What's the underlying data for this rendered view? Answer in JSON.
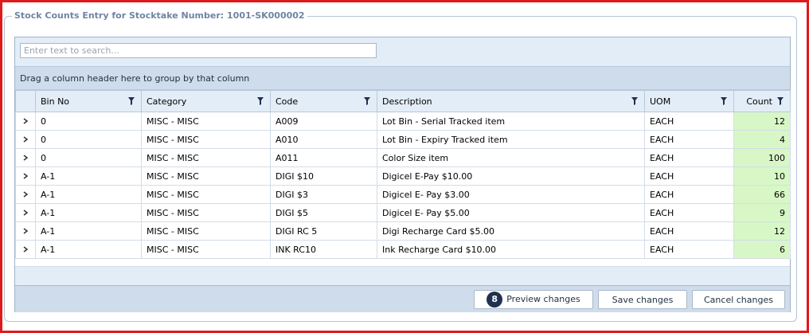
{
  "panel": {
    "title": "Stock Counts Entry for Stocktake Number: 1001-SK000002"
  },
  "search": {
    "placeholder": "Enter text to search..."
  },
  "group_panel": {
    "text": "Drag a column header here to group by that column"
  },
  "columns": [
    "Bin No",
    "Category",
    "Code",
    "Description",
    "UOM",
    "Count"
  ],
  "rows": [
    {
      "bin": "0",
      "category": "MISC - MISC",
      "code": "A009",
      "description": "Lot Bin - Serial Tracked item",
      "uom": "EACH",
      "count": "12"
    },
    {
      "bin": "0",
      "category": "MISC - MISC",
      "code": "A010",
      "description": "Lot Bin - Expiry Tracked item",
      "uom": "EACH",
      "count": "4"
    },
    {
      "bin": "0",
      "category": "MISC - MISC",
      "code": "A011",
      "description": "Color Size item",
      "uom": "EACH",
      "count": "100"
    },
    {
      "bin": "A-1",
      "category": "MISC - MISC",
      "code": "DIGI $10",
      "description": "Digicel E-Pay $10.00",
      "uom": "EACH",
      "count": "10"
    },
    {
      "bin": "A-1",
      "category": "MISC - MISC",
      "code": "DIGI $3",
      "description": "Digicel E- Pay $3.00",
      "uom": "EACH",
      "count": "66"
    },
    {
      "bin": "A-1",
      "category": "MISC - MISC",
      "code": "DIGI $5",
      "description": "Digicel E- Pay $5.00",
      "uom": "EACH",
      "count": "9"
    },
    {
      "bin": "A-1",
      "category": "MISC - MISC",
      "code": "DIGI RC 5",
      "description": "Digi Recharge Card $5.00",
      "uom": "EACH",
      "count": "12"
    },
    {
      "bin": "A-1",
      "category": "MISC - MISC",
      "code": "INK RC10",
      "description": "Ink Recharge Card $10.00",
      "uom": "EACH",
      "count": "6"
    }
  ],
  "footer": {
    "changes_count": "8",
    "preview_label": "Preview changes",
    "save_label": "Save changes",
    "cancel_label": "Cancel changes"
  },
  "icons": {
    "filter": "filter-icon",
    "expand": "chevron-right-icon"
  },
  "colors": {
    "frame_border": "#e0191b",
    "count_cell": "#d8f7c6",
    "badge": "#1e3150",
    "header_bg": "#e3edf7"
  }
}
